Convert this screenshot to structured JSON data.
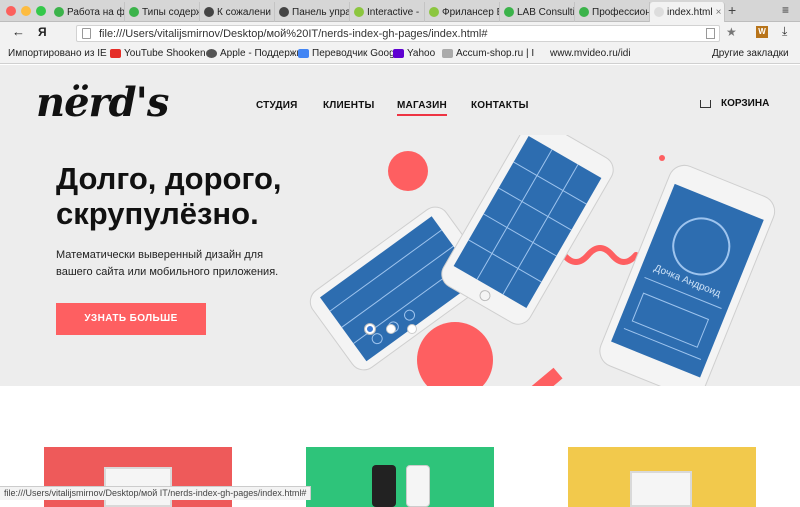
{
  "browser": {
    "tabs": [
      {
        "label": "Работа на фр",
        "color": "#3bb34a"
      },
      {
        "label": "Типы содерж",
        "color": "#3bb34a"
      },
      {
        "label": "К сожалени",
        "color": "#444444"
      },
      {
        "label": "Панель управ",
        "color": "#444444"
      },
      {
        "label": "Interactive - ",
        "color": "#8cc63f"
      },
      {
        "label": "Фрилансер В",
        "color": "#8cc63f"
      },
      {
        "label": "LAB Consultir",
        "color": "#3bb34a"
      },
      {
        "label": "Профессиона",
        "color": "#3bb34a"
      },
      {
        "label": "index.html",
        "color": "#dddddd",
        "active": true
      }
    ],
    "new_tab": "+",
    "menu_icon": "≡",
    "back": "←",
    "yandex": "Я",
    "url": "file:///Users/vitalijsmirnov/Desktop/мой%20IT/nerds-index-gh-pages/index.html#",
    "star": "★",
    "extension": "W",
    "download": "⤓",
    "bookmarks": [
      {
        "label": "Импортировано из IE",
        "color": "#666666"
      },
      {
        "label": "YouTube Shooken",
        "color": "#e52d27"
      },
      {
        "label": "Apple - Поддержк",
        "color": "#555555"
      },
      {
        "label": "Переводчик Goog",
        "color": "#4285f4"
      },
      {
        "label": "Yahoo",
        "color": "#5f01d1"
      },
      {
        "label": "Accum-shop.ru | I",
        "color": "#888888"
      },
      {
        "label": "www.mvideo.ru/idi",
        "color": "#ffffff"
      }
    ],
    "other_bookmarks": "Другие закладки",
    "status_url": "file:///Users/vitalijsmirnov/Desktop/мой IT/nerds-index-gh-pages/index.html#"
  },
  "site": {
    "logo": "nërd's",
    "nav": [
      "СТУДИЯ",
      "КЛИЕНТЫ",
      "МАГАЗИН",
      "КОНТАКТЫ"
    ],
    "active_nav": "МАГАЗИН",
    "cart": "КОРЗИНА",
    "hero_title": "Долго, дорого, скрупулёзно.",
    "hero_text": "Математически выверенный дизайн для вашего сайта или мобильного приложения.",
    "cta": "УЗНАТЬ БОЛЬШЕ",
    "slider_dots": 3,
    "active_slide": 1,
    "phone_title": "Дочка Андроид",
    "colors": {
      "accent": "#fe5f61",
      "hero_bg": "#ededed",
      "phone_screen": "#2d6db0",
      "card_red": "#ee5a5a",
      "card_green": "#2ec47a",
      "card_yellow": "#f2c94c"
    }
  }
}
